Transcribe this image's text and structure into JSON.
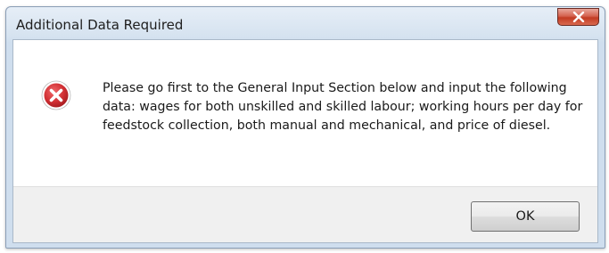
{
  "window": {
    "title": "Additional Data Required",
    "close_icon": "close-icon"
  },
  "message": {
    "icon": "error-icon",
    "text": "Please go first to the General Input Section below and input the following data: wages for both unskilled and skilled labour; working hours per day for feedstock collection, both manual and mechanical, and price of diesel."
  },
  "buttons": {
    "ok_label": "OK"
  },
  "colors": {
    "error_red": "#c8282c",
    "close_red": "#c23b22"
  }
}
